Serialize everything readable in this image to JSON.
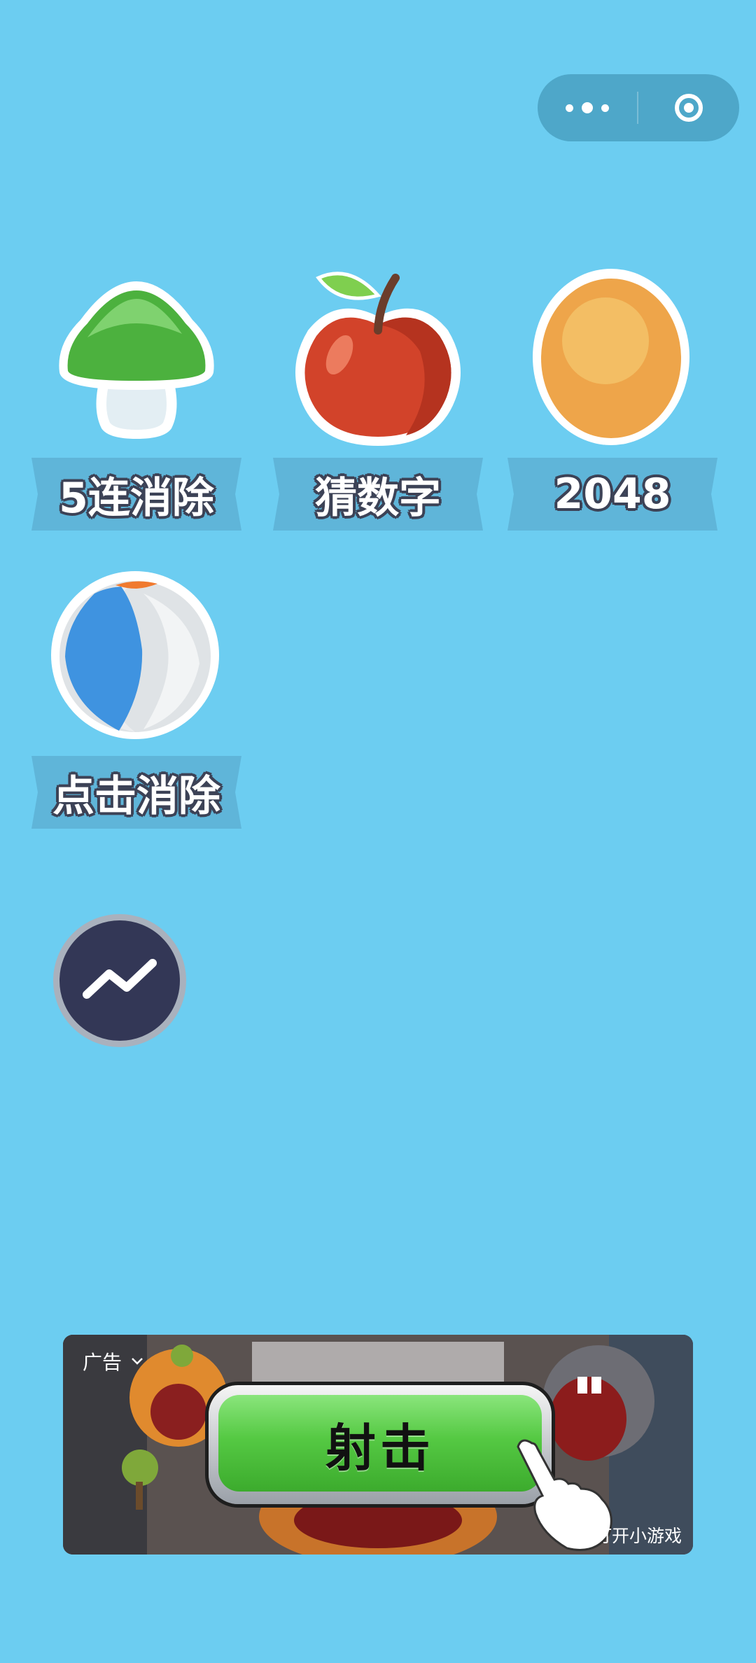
{
  "capsule": {
    "more_icon": "more-dots-icon",
    "close_icon": "target-circle-icon"
  },
  "games": [
    {
      "label": "5连消除",
      "icon": "mushroom-icon"
    },
    {
      "label": "猜数字",
      "icon": "apple-icon"
    },
    {
      "label": "2048",
      "icon": "egg-icon"
    },
    {
      "label": "点击消除",
      "icon": "ball-icon"
    }
  ],
  "trend_button": {
    "icon": "trend-line-icon"
  },
  "ad": {
    "label": "广告",
    "button_text": "射击",
    "open_text": "打开小游戏",
    "link_icon": "link-icon"
  },
  "colors": {
    "background": "#6ccdf1",
    "ribbon": "#5fb5d9",
    "capsule": "#4ea7c9",
    "trend_button": "#333756",
    "ad_button": "#55c943"
  }
}
